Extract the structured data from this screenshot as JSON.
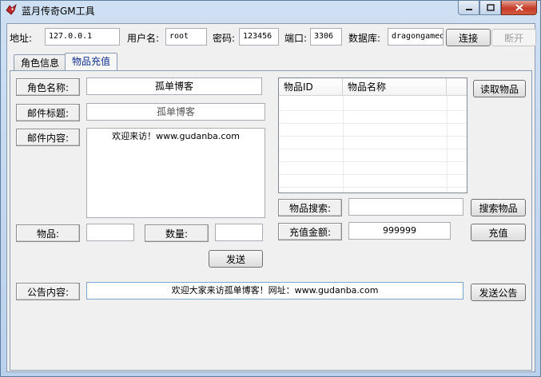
{
  "window": {
    "title": "蓝月传奇GM工具"
  },
  "connection": {
    "address_label": "地址:",
    "address_value": "127.0.0.1",
    "user_label": "用户名:",
    "user_value": "root",
    "password_label": "密码:",
    "password_value": "123456",
    "port_label": "端口:",
    "port_value": "3306",
    "db_label": "数据库:",
    "db_value": "dragongamed",
    "connect_button": "连接",
    "disconnect_button": "断开"
  },
  "tabs": [
    {
      "label": "角色信息"
    },
    {
      "label": "物品充值"
    }
  ],
  "mail": {
    "role_name_label": "角色名称:",
    "role_name_value": "孤单博客",
    "mail_title_label": "邮件标题:",
    "mail_title_value": "孤单博客",
    "mail_content_label": "邮件内容:",
    "mail_content_value": "欢迎来访！www.gudanba.com",
    "item_label": "物品:",
    "item_value": "",
    "quantity_label": "数量:",
    "quantity_value": "",
    "send_button": "发送"
  },
  "items": {
    "columns": [
      "物品ID",
      "物品名称"
    ],
    "read_button": "读取物品",
    "search_label": "物品搜索:",
    "search_value": "",
    "search_button": "搜索物品",
    "recharge_label": "充值金额:",
    "recharge_value": "999999",
    "recharge_button": "充值"
  },
  "announcement": {
    "label": "公告内容:",
    "value": "欢迎大家来访孤单博客！网址：www.gudanba.com",
    "send_button": "发送公告"
  },
  "colors": {
    "title_icon": "#c0282a",
    "close_button": "#c43b27",
    "active_tab_text": "#0f2f8f"
  },
  "icons": {
    "app": "red-bird-icon",
    "minimize": "minimize-icon",
    "maximize": "maximize-icon",
    "close": "close-icon"
  }
}
